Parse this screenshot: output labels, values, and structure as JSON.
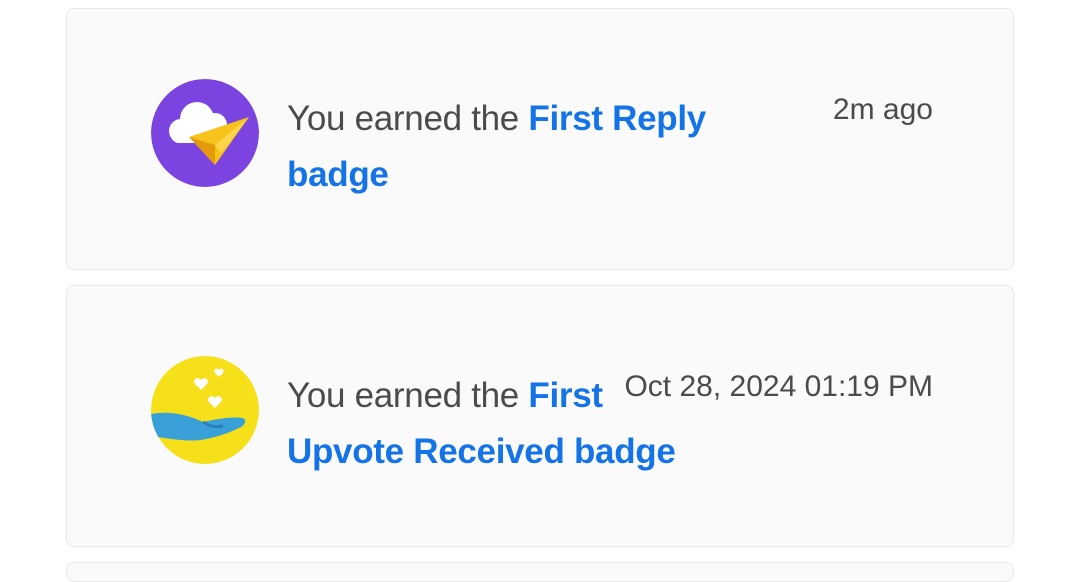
{
  "notifications": [
    {
      "prefix": "You earned the ",
      "badge_name": "First Reply",
      "suffix": "badge",
      "time": "2m ago",
      "icon": "paper-plane-cloud-badge-icon",
      "icon_bg": "#7b44e0"
    },
    {
      "prefix": "You earned the ",
      "badge_name": "First",
      "badge_name_cont": "Upvote Received badge",
      "time": "Oct 28, 2024 01:19 PM",
      "icon": "hand-hearts-badge-icon",
      "icon_bg": "#f5e01a"
    }
  ],
  "colors": {
    "link": "#1473e6",
    "text": "#4b4b4b",
    "card_bg": "#fafafa"
  }
}
